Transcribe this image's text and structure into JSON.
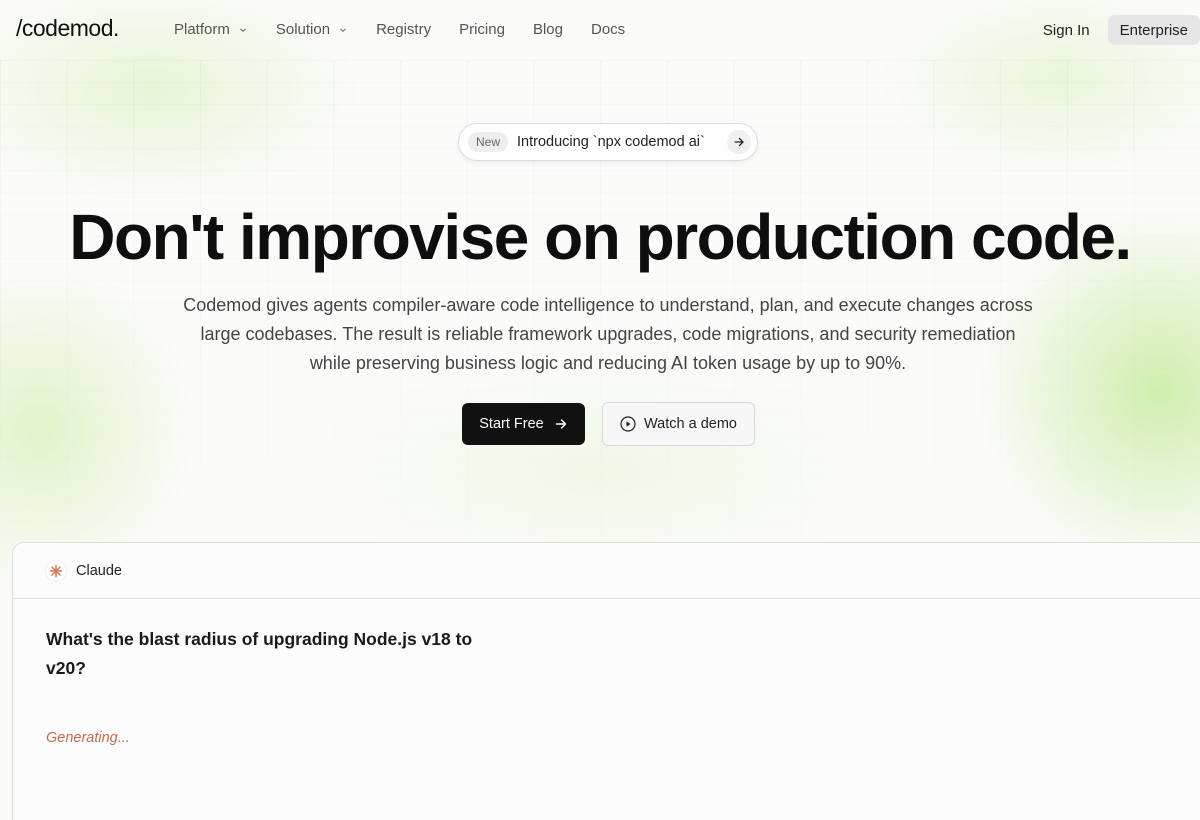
{
  "brand": {
    "logo_text": "/codemod."
  },
  "nav": {
    "links": [
      {
        "label": "Platform",
        "dropdown": true
      },
      {
        "label": "Solution",
        "dropdown": true
      },
      {
        "label": "Registry",
        "dropdown": false
      },
      {
        "label": "Pricing",
        "dropdown": false
      },
      {
        "label": "Blog",
        "dropdown": false
      },
      {
        "label": "Docs",
        "dropdown": false
      }
    ],
    "sign_in": "Sign In",
    "enterprise": "Enterprise"
  },
  "announcement": {
    "badge": "New",
    "text": "Introducing `npx codemod ai`",
    "icon": "arrow-right-icon"
  },
  "hero": {
    "title": "Don't improvise on production code.",
    "subtitle": "Codemod gives agents compiler-aware code intelligence to understand, plan, and execute changes across large codebases. The result is reliable framework upgrades, code migrations, and security remediation while preserving business logic and reducing AI token usage by up to 90%.",
    "primary_cta": "Start Free",
    "secondary_cta": "Watch a demo"
  },
  "chat": {
    "agent_name": "Claude",
    "agent_icon": "claude-sparkle-icon",
    "question": "What's the blast radius of upgrading Node.js v18 to v20?",
    "status": "Generating..."
  },
  "colors": {
    "accent_glow": "#c8eca0",
    "primary_button": "#111111",
    "generating_text": "#c86a4a",
    "claude_orange": "#d97757"
  }
}
